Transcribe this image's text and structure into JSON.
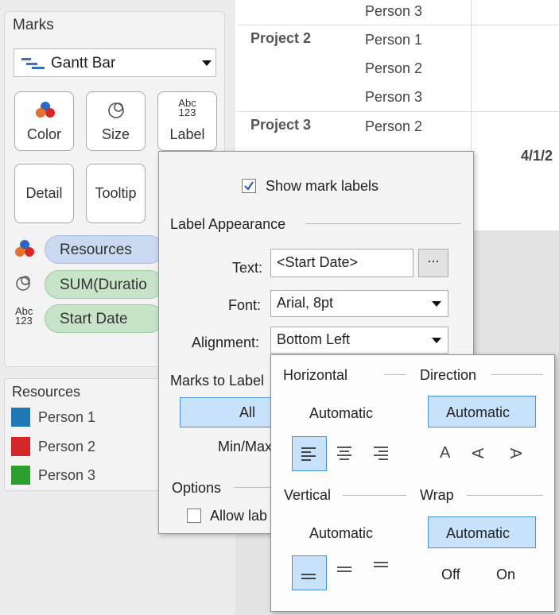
{
  "marks": {
    "title": "Marks",
    "mark_type": "Gantt Bar",
    "buttons": {
      "color": "Color",
      "size": "Size",
      "label": "Label",
      "label_icon": "Abc\n123",
      "detail": "Detail",
      "tooltip": "Tooltip"
    },
    "pills": [
      {
        "text": "Resources",
        "icon": "color-icon"
      },
      {
        "text": "SUM(Duratio",
        "icon": "size-icon"
      },
      {
        "text": "Start Date",
        "icon": "label-icon"
      }
    ]
  },
  "legend": {
    "title": "Resources",
    "items": [
      {
        "name": "Person 1",
        "color": "#1f77b4"
      },
      {
        "name": "Person 2",
        "color": "#d62728"
      },
      {
        "name": "Person 3",
        "color": "#2ca02c"
      }
    ]
  },
  "table": {
    "rows": [
      {
        "project": "",
        "person": "Person 3"
      },
      {
        "project": "Project 2",
        "person": "Person 1"
      },
      {
        "project": "",
        "person": "Person 2"
      },
      {
        "project": "",
        "person": "Person 3"
      },
      {
        "project": "Project 3",
        "person": "Person 2"
      }
    ],
    "partial_person": "Person 3",
    "partial_date": "4/1/2"
  },
  "label_dialog": {
    "show_mark_labels": "Show mark labels",
    "show_checked": true,
    "label_appearance": "Label Appearance",
    "text_label": "Text:",
    "text_value": "<Start Date>",
    "ellipsis": "...",
    "font_label": "Font:",
    "font_value": "Arial, 8pt",
    "alignment_label": "Alignment:",
    "alignment_value": "Bottom Left",
    "marks_to_label": "Marks to Label",
    "all": "All",
    "minmax": "Min/Max",
    "options": "Options",
    "allow_labels": "Allow lab"
  },
  "alignment_popup": {
    "horizontal": "Horizontal",
    "direction": "Direction",
    "vertical": "Vertical",
    "wrap": "Wrap",
    "automatic": "Automatic",
    "off": "Off",
    "on": "On",
    "dir_glyphs": [
      "A",
      "A",
      "A"
    ]
  },
  "colors": {
    "accent_selected": "#c8e2fb",
    "accent_border": "#4a90d9",
    "pill_blue": "#c9d9f0",
    "pill_green": "#c7e3c8"
  }
}
